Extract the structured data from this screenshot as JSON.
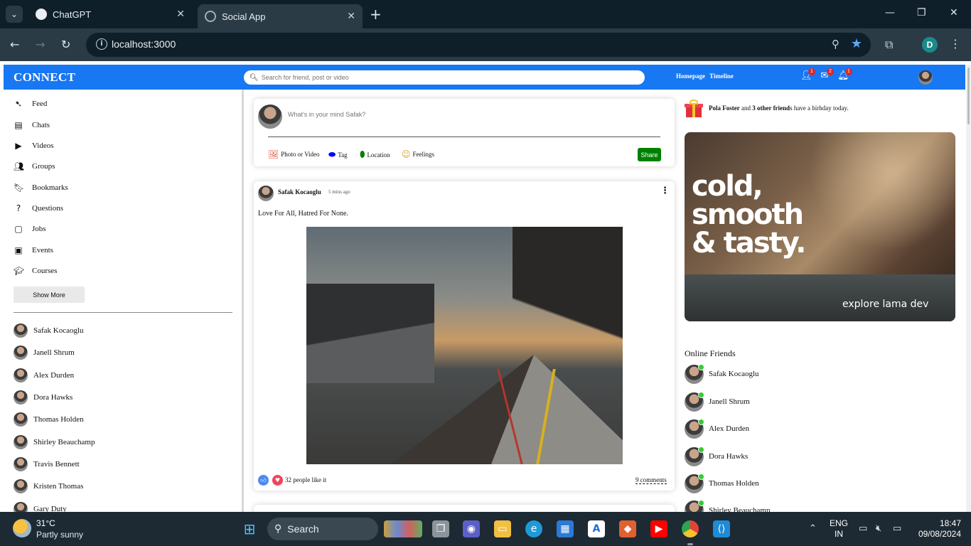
{
  "browser": {
    "tabs": [
      {
        "title": "ChatGPT",
        "active": false
      },
      {
        "title": "Social App",
        "active": true
      }
    ],
    "url": "localhost:3000",
    "profile_initial": "D"
  },
  "app": {
    "logo": "CONNECT",
    "search_placeholder": "Search for friend, post or video",
    "links": [
      "Homepage",
      "Timeline"
    ],
    "badges": {
      "friends": "1",
      "chat": "2",
      "notifications": "1"
    },
    "colors": {
      "primary": "#1877f2",
      "share": "#008000",
      "online": "#32cd32",
      "badge": "#e0242a"
    }
  },
  "sidebar": {
    "menu": [
      {
        "label": "Feed",
        "icon": "rss-icon"
      },
      {
        "label": "Chats",
        "icon": "chat-icon"
      },
      {
        "label": "Videos",
        "icon": "play-icon"
      },
      {
        "label": "Groups",
        "icon": "group-icon"
      },
      {
        "label": "Bookmarks",
        "icon": "bookmark-icon"
      },
      {
        "label": "Questions",
        "icon": "help-icon"
      },
      {
        "label": "Jobs",
        "icon": "briefcase-icon"
      },
      {
        "label": "Events",
        "icon": "calendar-icon"
      },
      {
        "label": "Courses",
        "icon": "school-icon"
      }
    ],
    "show_more": "Show More",
    "friends": [
      "Safak Kocaoglu",
      "Janell Shrum",
      "Alex Durden",
      "Dora Hawks",
      "Thomas Holden",
      "Shirley Beauchamp",
      "Travis Bennett",
      "Kristen Thomas",
      "Gary Duty"
    ]
  },
  "share": {
    "placeholder": "What's in your mind Safak?",
    "options": [
      "Photo or Video",
      "Tag",
      "Location",
      "Feelings"
    ],
    "button": "Share"
  },
  "post": {
    "user": "Safak Kocaoglu",
    "time": "5 mins ago",
    "text": "Love For All, Hatred For None.",
    "likes": "32 people like it",
    "comments": "9 comments"
  },
  "rightbar": {
    "birthday": {
      "name": "Pola Foster",
      "mid": " and ",
      "others": "3 other friend",
      "tail": "s have a birhday today."
    },
    "ad": {
      "headline": "cold,\nsmooth\n& tasty.",
      "sub": "explore lama dev"
    },
    "online_title": "Online Friends",
    "online": [
      "Safak Kocaoglu",
      "Janell Shrum",
      "Alex Durden",
      "Dora Hawks",
      "Thomas Holden",
      "Shirley Beauchamp"
    ]
  },
  "taskbar": {
    "weather_temp": "31°C",
    "weather_desc": "Partly sunny",
    "search": "Search",
    "lang_top": "ENG",
    "lang_bottom": "IN",
    "time": "18:47",
    "date": "09/08/2024"
  }
}
